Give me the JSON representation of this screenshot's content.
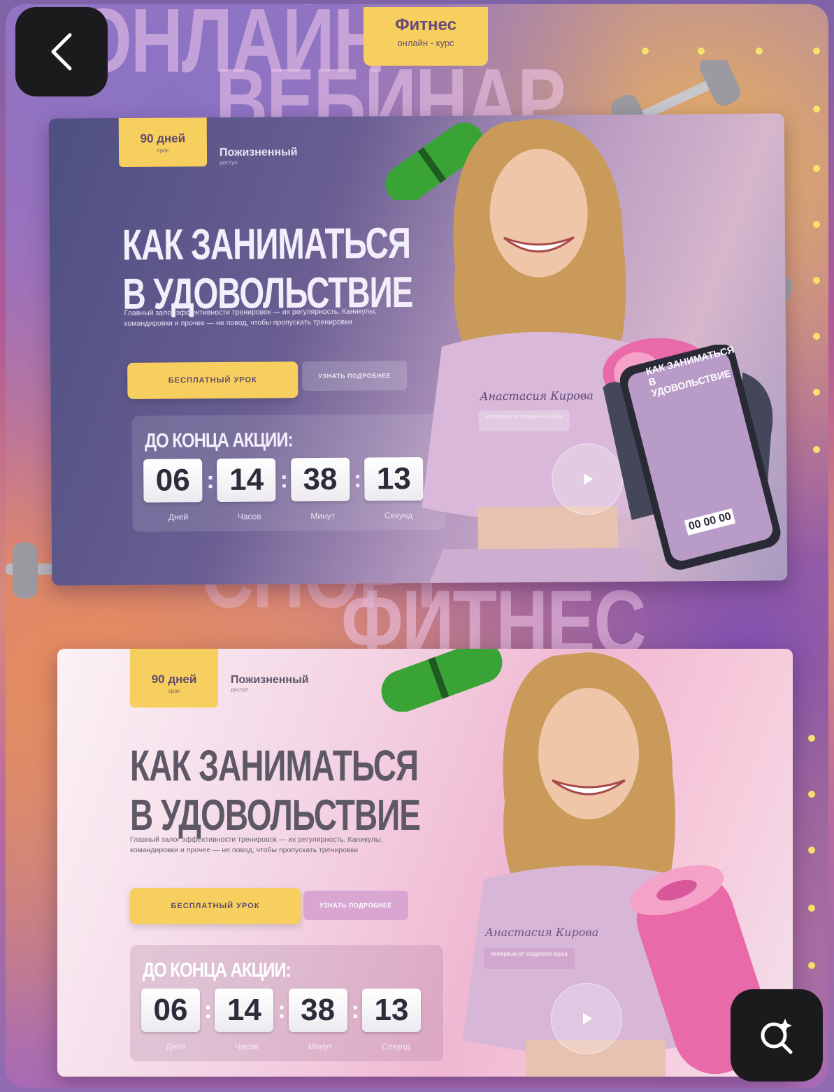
{
  "nav": {
    "back_label": "back"
  },
  "background": {
    "word_top1": "ОНЛАЙН",
    "word_top2": "ВЕБИНАР",
    "word_mid1": "СПОРТ",
    "word_mid2": "ФИТНЕС"
  },
  "top_tag": {
    "title": "Фитнес",
    "subtitle": "онлайн - курс"
  },
  "banners": [
    {
      "tag_main": "90 дней",
      "tag_sub": "срок",
      "access_main": "Пожизненный",
      "access_sub": "доступ",
      "headline_line1": "КАК ЗАНИМАТЬСЯ",
      "headline_line2": "В УДОВОЛЬСТВИЕ",
      "description": "Главный залог эффективности тренировок — их регулярность. Каникулы, командировки и прочее — не повод, чтобы пропускать тренировки",
      "primary_button": "БЕСПЛАТНЫЙ УРОК",
      "secondary_button": "УЗНАТЬ ПОДРОБНЕЕ",
      "timer_title": "ДО КОНЦА АКЦИИ:",
      "timer": {
        "days": "06",
        "hours": "14",
        "minutes": "38",
        "seconds": "13"
      },
      "timer_labels": {
        "days": "Дней",
        "hours": "Часов",
        "minutes": "Минут",
        "seconds": "Секунд"
      },
      "signature": "Анастасия Кирова",
      "signature_sub": "Интервью от создателя курса"
    },
    {
      "tag_main": "90 дней",
      "tag_sub": "срок",
      "access_main": "Пожизненный",
      "access_sub": "доступ",
      "headline_line1": "КАК ЗАНИМАТЬСЯ",
      "headline_line2": "В УДОВОЛЬСТВИЕ",
      "description": "Главный залог эффективности тренировок — их регулярность. Каникулы, командировки и прочее — не повод, чтобы пропускать тренировки",
      "primary_button": "БЕСПЛАТНЫЙ УРОК",
      "secondary_button": "УЗНАТЬ ПОДРОБНЕЕ",
      "timer_title": "ДО КОНЦА АКЦИИ:",
      "timer": {
        "days": "06",
        "hours": "14",
        "minutes": "38",
        "seconds": "13"
      },
      "timer_labels": {
        "days": "Дней",
        "hours": "Часов",
        "minutes": "Минут",
        "seconds": "Секунд"
      },
      "signature": "Анастасия Кирова",
      "signature_sub": "Интервью от создателя курса"
    }
  ],
  "phone": {
    "headline_line1": "КАК ЗАНИМАТЬСЯ",
    "headline_line2": "В УДОВОЛЬСТВИЕ",
    "timer_text": "00 00 00"
  },
  "colors": {
    "accent_yellow": "#f7cf5e",
    "mat_green": "#3aa336",
    "mat_pink": "#e86aa8"
  },
  "icons": {
    "back": "chevron-left-icon",
    "zoom": "visual-search-icon",
    "play": "play-icon"
  }
}
